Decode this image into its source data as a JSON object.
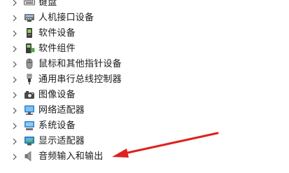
{
  "device_tree": {
    "items": [
      {
        "label": "键盘",
        "icon": "keyboard-icon"
      },
      {
        "label": "人机接口设备",
        "icon": "hid-icon"
      },
      {
        "label": "软件设备",
        "icon": "software-device-icon"
      },
      {
        "label": "软件组件",
        "icon": "software-component-icon"
      },
      {
        "label": "鼠标和其他指针设备",
        "icon": "mouse-icon"
      },
      {
        "label": "通用串行总线控制器",
        "icon": "usb-icon"
      },
      {
        "label": "图像设备",
        "icon": "camera-icon"
      },
      {
        "label": "网络适配器",
        "icon": "network-adapter-icon"
      },
      {
        "label": "系统设备",
        "icon": "system-device-icon"
      },
      {
        "label": "显示适配器",
        "icon": "display-adapter-icon"
      },
      {
        "label": "音频输入和输出",
        "icon": "audio-icon"
      }
    ]
  },
  "annotation": {
    "icon": "red-arrow-icon",
    "color": "#e02020"
  }
}
